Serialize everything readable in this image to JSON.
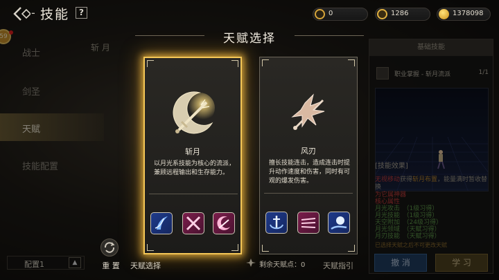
{
  "header": {
    "title": "技能",
    "help": "?",
    "currencies": [
      {
        "icon": "crystal-icon",
        "value": "0"
      },
      {
        "icon": "gem-icon",
        "value": "1286"
      },
      {
        "icon": "gold-coin-icon",
        "value": "1378098"
      }
    ]
  },
  "sidebar": {
    "badge": "59",
    "items": [
      {
        "label": "战士"
      },
      {
        "label": "剑圣"
      },
      {
        "label": "天赋"
      },
      {
        "label": "技能配置"
      }
    ],
    "config": "配置1"
  },
  "background": {
    "tab": "斩 月"
  },
  "modal": {
    "title": "天赋选择",
    "cards": [
      {
        "name": "斩月",
        "desc": "以月光系技能为核心的流派，兼顾远程输出和生存能力。",
        "selected": true
      },
      {
        "name": "风刃",
        "desc": "擅长技能连击，造成连击时提升动作速度和伤害，同时有可观的爆发伤害。",
        "selected": false
      }
    ]
  },
  "bottom": {
    "reset": "重 置",
    "talent_select": "天赋选择",
    "remaining": "剩余天赋点：0",
    "guide": "天赋指引"
  },
  "right_panel": {
    "header": "基础技能",
    "skill_name": "职业掌握 - 斩月流派",
    "skill_count": "1/1",
    "effect_header": "[技能效果]",
    "effect_line1_a": "无视移动",
    "effect_line1_b": "获得",
    "effect_line1_c": "斩月布置",
    "effect_line1_d": "，能量满时暂收替换",
    "effect_line2": "为它属神器",
    "stats_header": "核心属性",
    "stats": [
      "月光攻击　（1级习得）",
      "月光技能　（1级习得）",
      "天空附加　（24级习得）",
      "月光领域　（天赋习得）",
      "月刃技能　（天赋习得）"
    ],
    "note": "已选择天赋之后不可更改天赋",
    "cancel": "撤 消",
    "learn": "学 习"
  }
}
